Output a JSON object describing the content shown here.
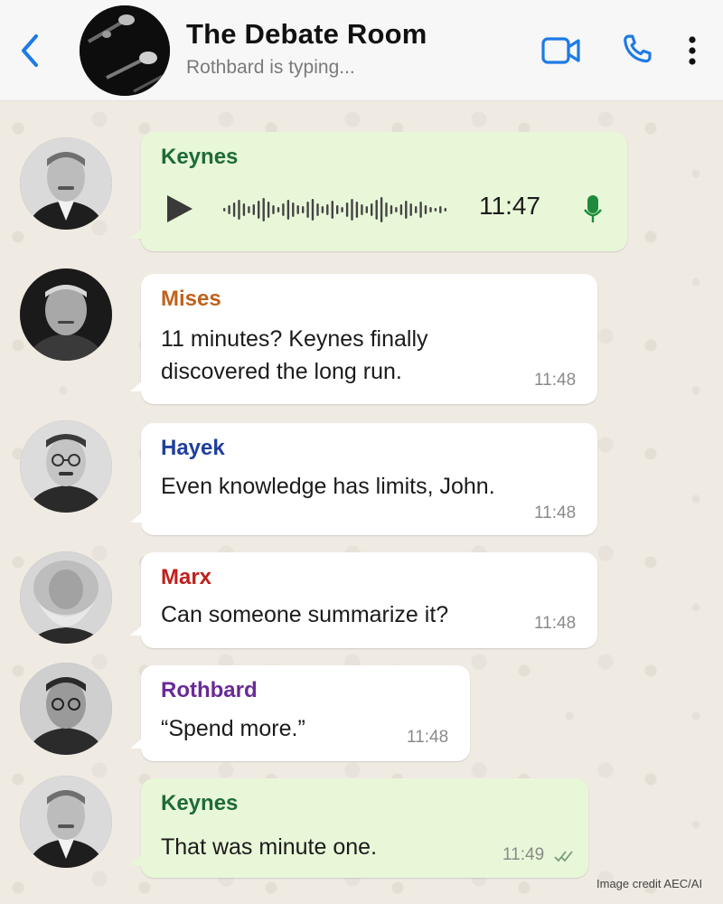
{
  "header": {
    "title": "The Debate Room",
    "status": "Rothbard is typing..."
  },
  "icons": {
    "back": "chevron-left-icon",
    "video": "video-camera-icon",
    "call": "phone-icon",
    "more": "vertical-dots-icon"
  },
  "colors": {
    "accent_blue": "#1e7ae6",
    "keynes": "#1e6b37",
    "mises": "#c0621c",
    "hayek": "#1f3f9c",
    "marx": "#c0201c",
    "rothbard": "#6a2a98",
    "outgoing_bubble": "#e8f7d8",
    "incoming_bubble": "#ffffff",
    "read_ticks": "#7a9a7a"
  },
  "messages": [
    {
      "sender": "Keynes",
      "type": "voice",
      "duration": "11:47"
    },
    {
      "sender": "Mises",
      "type": "text",
      "lines": [
        "11 minutes? Keynes finally",
        "discovered the long run."
      ],
      "time": "11:48"
    },
    {
      "sender": "Hayek",
      "type": "text",
      "lines": [
        "Even knowledge has limits, John."
      ],
      "time": "11:48"
    },
    {
      "sender": "Marx",
      "type": "text",
      "lines": [
        "Can someone summarize it?"
      ],
      "time": "11:48"
    },
    {
      "sender": "Rothbard",
      "type": "text",
      "lines": [
        "“Spend more.”"
      ],
      "time": "11:48"
    },
    {
      "sender": "Keynes",
      "type": "text",
      "lines": [
        "That was minute one."
      ],
      "time": "11:49",
      "status": "read"
    }
  ],
  "credit": "Image credit AEC/AI"
}
